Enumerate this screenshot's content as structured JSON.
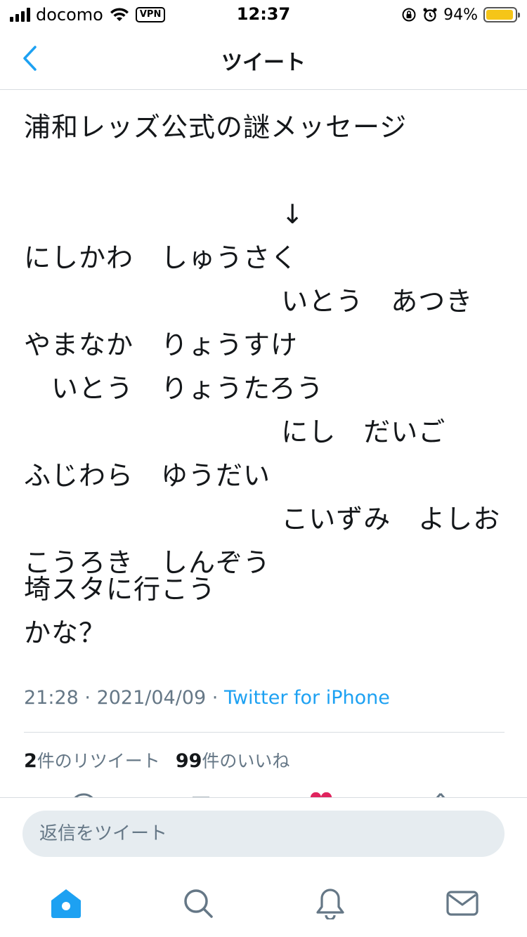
{
  "status_bar": {
    "carrier": "docomo",
    "vpn": "VPN",
    "time": "12:37",
    "battery_percent": "94%",
    "battery_level": 0.94
  },
  "nav": {
    "title": "ツイート"
  },
  "tweet": {
    "text": "浦和レッズ公式の謎メッセージ\n\n                            ↓\nにしかわ　しゅうさく\n                            いとう　あつき\nやまなか　りょうすけ\n　いとう　りょうたろう\n                            にし　だいご\nふじわら　ゆうだい\n                            こいずみ　よしお\nこうろき　しんぞう",
    "closing": "埼スタに行こう\nかな？",
    "time": "21:28",
    "date": "2021/04/09",
    "client": "Twitter for iPhone",
    "separator": " · "
  },
  "stats": {
    "retweets_count": "2",
    "retweets_label": "件のリツイート",
    "likes_count": "99",
    "likes_label": "件のいいね"
  },
  "reply": {
    "placeholder": "返信をツイート"
  },
  "colors": {
    "accent": "#1da1f2",
    "like": "#e0245e",
    "muted": "#657786"
  },
  "tabbar": {
    "items": [
      "home-icon",
      "search-icon",
      "notifications-icon",
      "messages-icon"
    ]
  }
}
